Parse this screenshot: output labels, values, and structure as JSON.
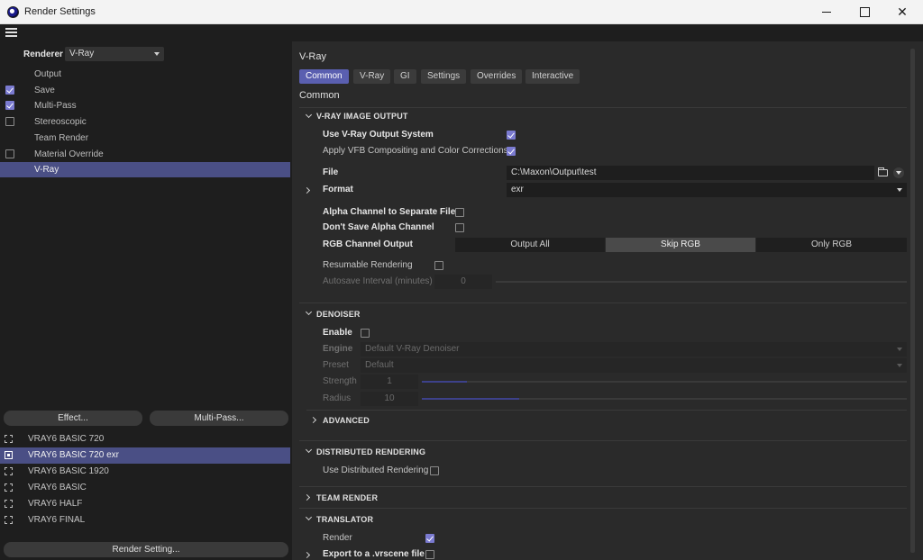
{
  "window": {
    "title": "Render Settings"
  },
  "left": {
    "renderer_label": "Renderer",
    "renderer_value": "V-Ray",
    "tree": [
      {
        "label": "Output",
        "checkbox": false,
        "checked": false
      },
      {
        "label": "Save",
        "checkbox": true,
        "checked": true
      },
      {
        "label": "Multi-Pass",
        "checkbox": true,
        "checked": true
      },
      {
        "label": "Stereoscopic",
        "checkbox": true,
        "checked": false
      },
      {
        "label": "Team Render",
        "checkbox": false,
        "checked": false
      },
      {
        "label": "Material Override",
        "checkbox": true,
        "checked": false
      },
      {
        "label": "V-Ray",
        "checkbox": false,
        "checked": false
      }
    ],
    "effect_button": "Effect...",
    "multipass_button": "Multi-Pass...",
    "presets": [
      "VRAY6 BASIC 720",
      "VRAY6 BASIC 720 exr",
      "VRAY6 BASIC 1920",
      "VRAY6 BASIC",
      "VRAY6 HALF",
      "VRAY6 FINAL"
    ],
    "render_setting_button": "Render Setting..."
  },
  "right": {
    "title": "V-Ray",
    "tabs": [
      "Common",
      "V-Ray",
      "GI",
      "Settings",
      "Overrides",
      "Interactive"
    ],
    "subtitle": "Common",
    "image_output": {
      "header": "V-RAY IMAGE OUTPUT",
      "use_output_system": "Use V-Ray Output System",
      "apply_vfb": "Apply VFB Compositing and Color Corrections",
      "file_label": "File",
      "file_value": "C:\\Maxon\\Output\\test",
      "format_label": "Format",
      "format_value": "exr",
      "alpha_separate": "Alpha Channel to Separate File",
      "dont_save_alpha": "Don't Save Alpha Channel",
      "rgb_label": "RGB Channel Output",
      "rgb_options": [
        "Output All",
        "Skip RGB",
        "Only RGB"
      ],
      "resumable": "Resumable Rendering",
      "autosave_label": "Autosave Interval (minutes)",
      "autosave_value": "0"
    },
    "denoiser": {
      "header": "DENOISER",
      "enable": "Enable",
      "engine_label": "Engine",
      "engine_value": "Default V-Ray Denoiser",
      "preset_label": "Preset",
      "preset_value": "Default",
      "strength_label": "Strength",
      "strength_value": "1",
      "radius_label": "Radius",
      "radius_value": "10",
      "advanced": "ADVANCED"
    },
    "distributed": {
      "header": "DISTRIBUTED RENDERING",
      "use": "Use Distributed Rendering"
    },
    "team_render": {
      "header": "TEAM RENDER"
    },
    "translator": {
      "header": "TRANSLATOR",
      "render": "Render",
      "export": "Export to a .vrscene file"
    }
  }
}
